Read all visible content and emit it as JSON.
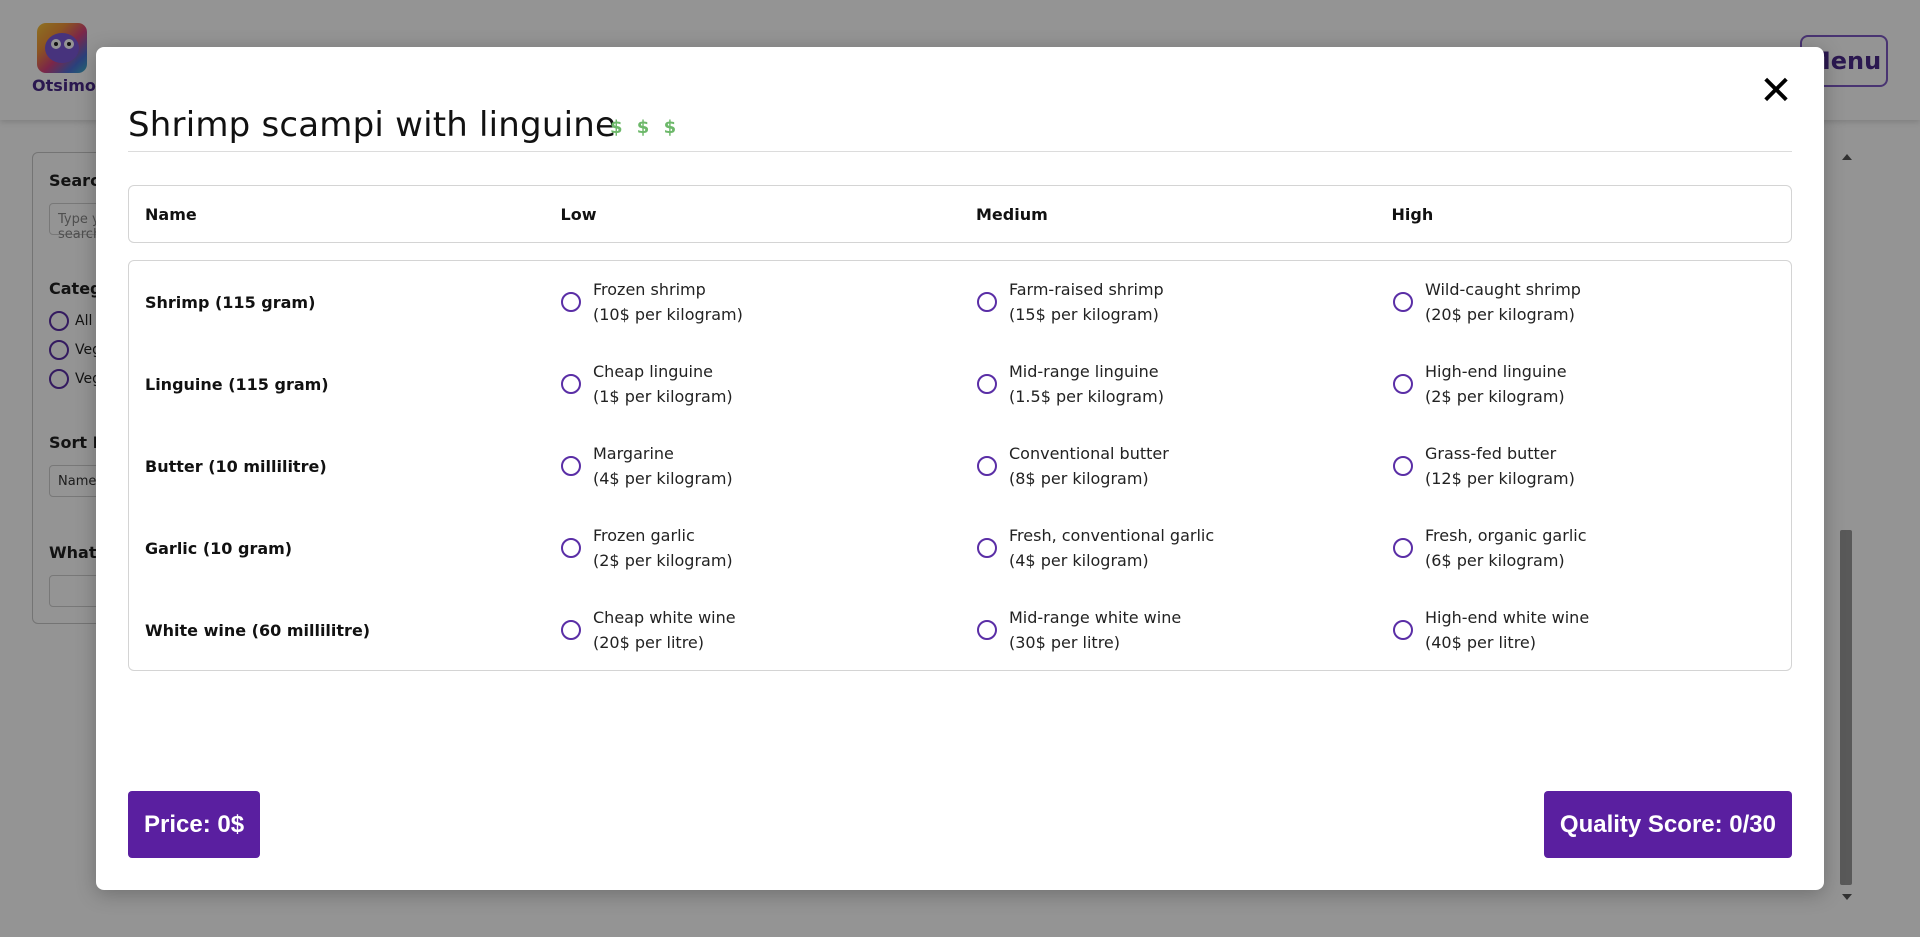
{
  "app": {
    "logo_text": "Otsimo",
    "menu_label": "Menu"
  },
  "filters": {
    "search_label": "Search",
    "search_placeholder": "Type your search",
    "category_label": "Category",
    "category_options": [
      "All",
      "Vegetarian",
      "Vegan"
    ],
    "sort_label": "Sort By",
    "sort_value": "Name",
    "what_label": "What"
  },
  "modal": {
    "title": "Shrimp scampi with linguine",
    "price_tier": "$ $ $",
    "close_icon": "close-icon",
    "columns": [
      "Name",
      "Low",
      "Medium",
      "High"
    ],
    "rows": [
      {
        "name": "Shrimp (115 gram)",
        "low": {
          "label": "Frozen shrimp",
          "price": "(10$ per kilogram)"
        },
        "medium": {
          "label": "Farm-raised shrimp",
          "price": "(15$ per kilogram)"
        },
        "high": {
          "label": "Wild-caught shrimp",
          "price": "(20$ per kilogram)"
        }
      },
      {
        "name": "Linguine (115 gram)",
        "low": {
          "label": "Cheap linguine",
          "price": "(1$ per kilogram)"
        },
        "medium": {
          "label": "Mid-range linguine",
          "price": "(1.5$ per kilogram)"
        },
        "high": {
          "label": "High-end linguine",
          "price": "(2$ per kilogram)"
        }
      },
      {
        "name": "Butter (10 millilitre)",
        "low": {
          "label": "Margarine",
          "price": "(4$ per kilogram)"
        },
        "medium": {
          "label": "Conventional butter",
          "price": "(8$ per kilogram)"
        },
        "high": {
          "label": "Grass-fed butter",
          "price": "(12$ per kilogram)"
        }
      },
      {
        "name": "Garlic (10 gram)",
        "low": {
          "label": "Frozen garlic",
          "price": "(2$ per kilogram)"
        },
        "medium": {
          "label": "Fresh, conventional garlic",
          "price": "(4$ per kilogram)"
        },
        "high": {
          "label": "Fresh, organic garlic",
          "price": "(6$ per kilogram)"
        }
      },
      {
        "name": "White wine (60 millilitre)",
        "low": {
          "label": "Cheap white wine",
          "price": "(20$ per litre)"
        },
        "medium": {
          "label": "Mid-range white wine",
          "price": "(30$ per litre)"
        },
        "high": {
          "label": "High-end white wine",
          "price": "(40$ per litre)"
        }
      }
    ],
    "price_text": "Price: 0$",
    "quality_text": "Quality Score: 0/30"
  },
  "colors": {
    "accent": "#5a1fa0",
    "price_tier": "#6db86a",
    "radio_border": "#5a2ea6"
  }
}
